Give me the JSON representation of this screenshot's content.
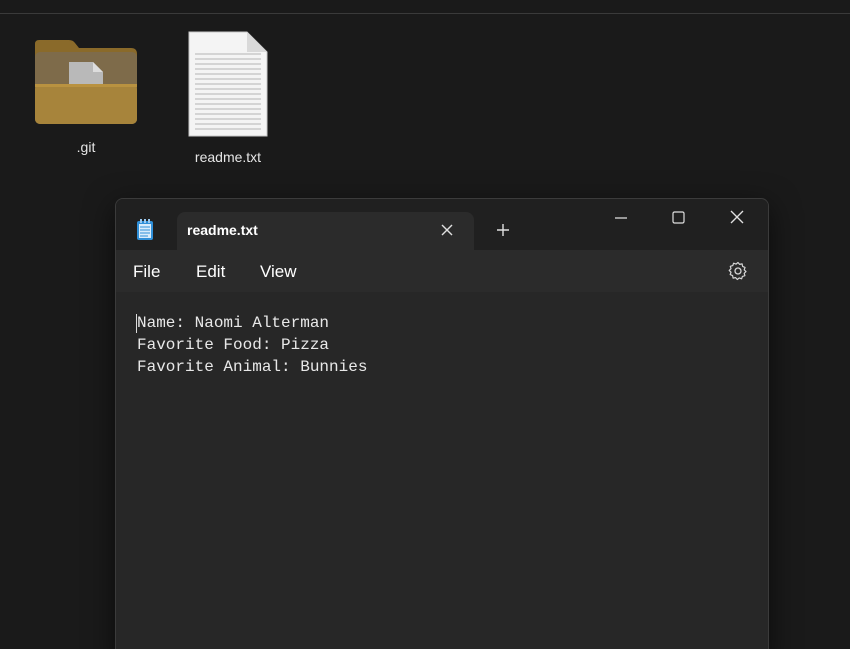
{
  "desktop": {
    "items": [
      {
        "label": ".git",
        "icon": "folder-icon"
      },
      {
        "label": "readme.txt",
        "icon": "text-file-icon"
      }
    ]
  },
  "window": {
    "app_icon": "notepad-icon",
    "tab": {
      "title": "readme.txt"
    },
    "controls": [
      "minimize",
      "maximize",
      "close"
    ],
    "menu": {
      "file": "File",
      "edit": "Edit",
      "view": "View"
    },
    "settings_icon": "gear-icon",
    "content": {
      "lines": [
        "Name: Naomi Alterman",
        "Favorite Food: Pizza",
        "Favorite Animal: Bunnies"
      ]
    }
  },
  "colors": {
    "desktop_bg": "#1a1a1a",
    "titlebar": "#202020",
    "tab_bg": "#2b2b2b",
    "editor_bg": "#272727",
    "text": "#e8e8e8",
    "folder": "#b08a3a",
    "notepad_accent": "#2f8fd8"
  }
}
